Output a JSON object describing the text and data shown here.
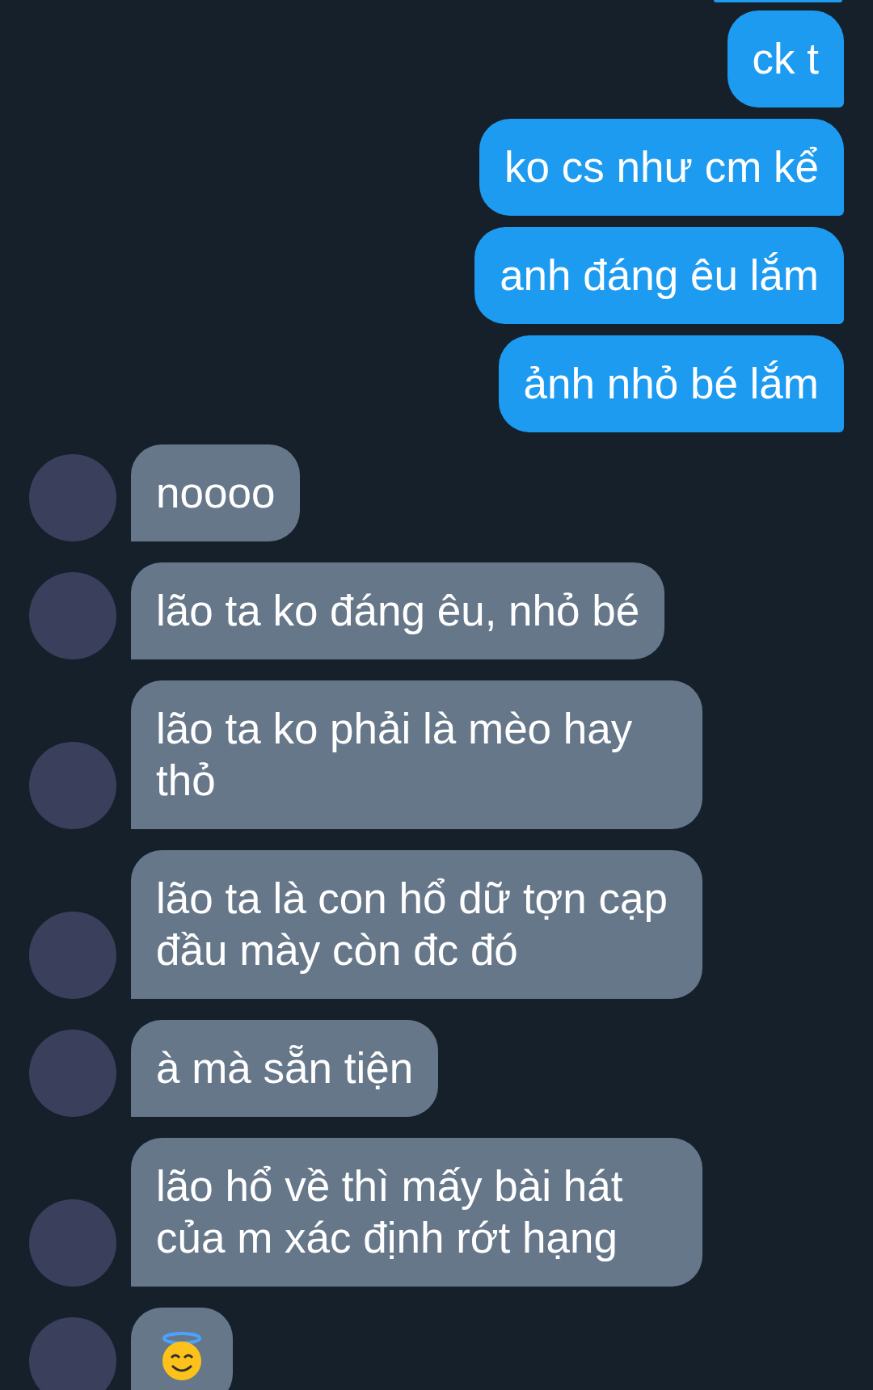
{
  "messages": [
    {
      "outgoing": true,
      "kind": "text",
      "text": "ck t"
    },
    {
      "outgoing": true,
      "kind": "text",
      "text": "ko cs như cm kể"
    },
    {
      "outgoing": true,
      "kind": "text",
      "text": "anh đáng êu lắm"
    },
    {
      "outgoing": true,
      "kind": "text",
      "text": "ảnh nhỏ bé lắm"
    },
    {
      "outgoing": false,
      "kind": "text",
      "text": "noooo"
    },
    {
      "outgoing": false,
      "kind": "text",
      "text": "lão ta ko đáng êu, nhỏ bé"
    },
    {
      "outgoing": false,
      "kind": "text",
      "text": "lão ta ko phải là mèo hay thỏ"
    },
    {
      "outgoing": false,
      "kind": "text",
      "text": "lão ta là con hổ dữ tợn cạp đầu mày còn đc đó"
    },
    {
      "outgoing": false,
      "kind": "text",
      "text": "à mà sẵn tiện"
    },
    {
      "outgoing": false,
      "kind": "text",
      "text": "lão hổ về thì mấy bài hát của m xác định rớt hạng"
    },
    {
      "outgoing": false,
      "kind": "emoji"
    }
  ]
}
